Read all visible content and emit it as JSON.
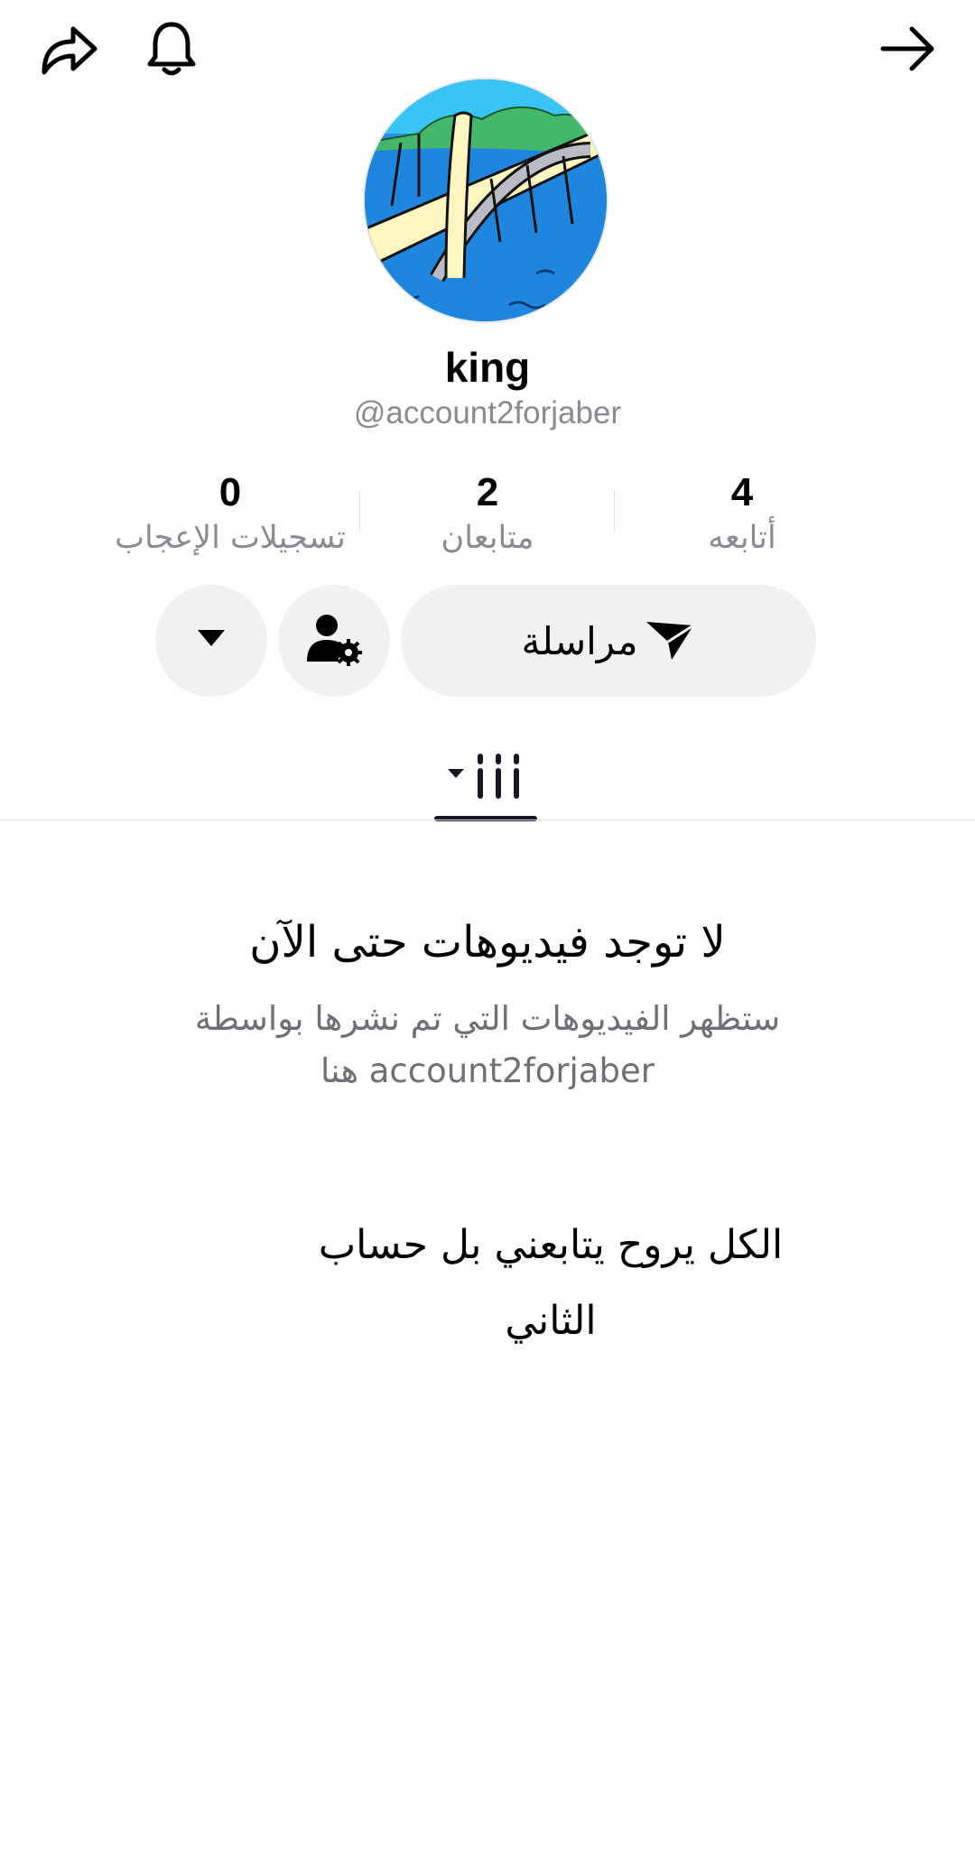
{
  "header": {
    "share_icon": "share-arrow-icon",
    "notification_icon": "bell-icon",
    "back_icon": "arrow-right-icon"
  },
  "profile": {
    "display_name": "king",
    "username": "@account2forjaber",
    "avatar_icon": "bridge-illustration"
  },
  "stats": [
    {
      "value": "0",
      "label": "تسجيلات الإعجاب"
    },
    {
      "value": "2",
      "label": "متابعان"
    },
    {
      "value": "4",
      "label": "أتابعه"
    }
  ],
  "actions": {
    "message_label": "مراسلة",
    "message_icon": "paper-plane-icon",
    "user_settings_icon": "user-gear-icon",
    "more_icon": "caret-down-icon"
  },
  "tabs": {
    "videos_icon": "grid-columns-icon"
  },
  "empty_state": {
    "title": "لا توجد فيديوهات حتى الآن",
    "line1": "ستظهر الفيديوهات التي تم نشرها بواسطة",
    "line2": "account2forjaber هنا"
  },
  "bio": {
    "line1": "الكل يروح يتابعني بل حساب",
    "line2": "الثاني"
  },
  "colors": {
    "button_bg": "#f1f1f2",
    "text_primary": "#000000",
    "text_secondary": "#8a8b91"
  }
}
